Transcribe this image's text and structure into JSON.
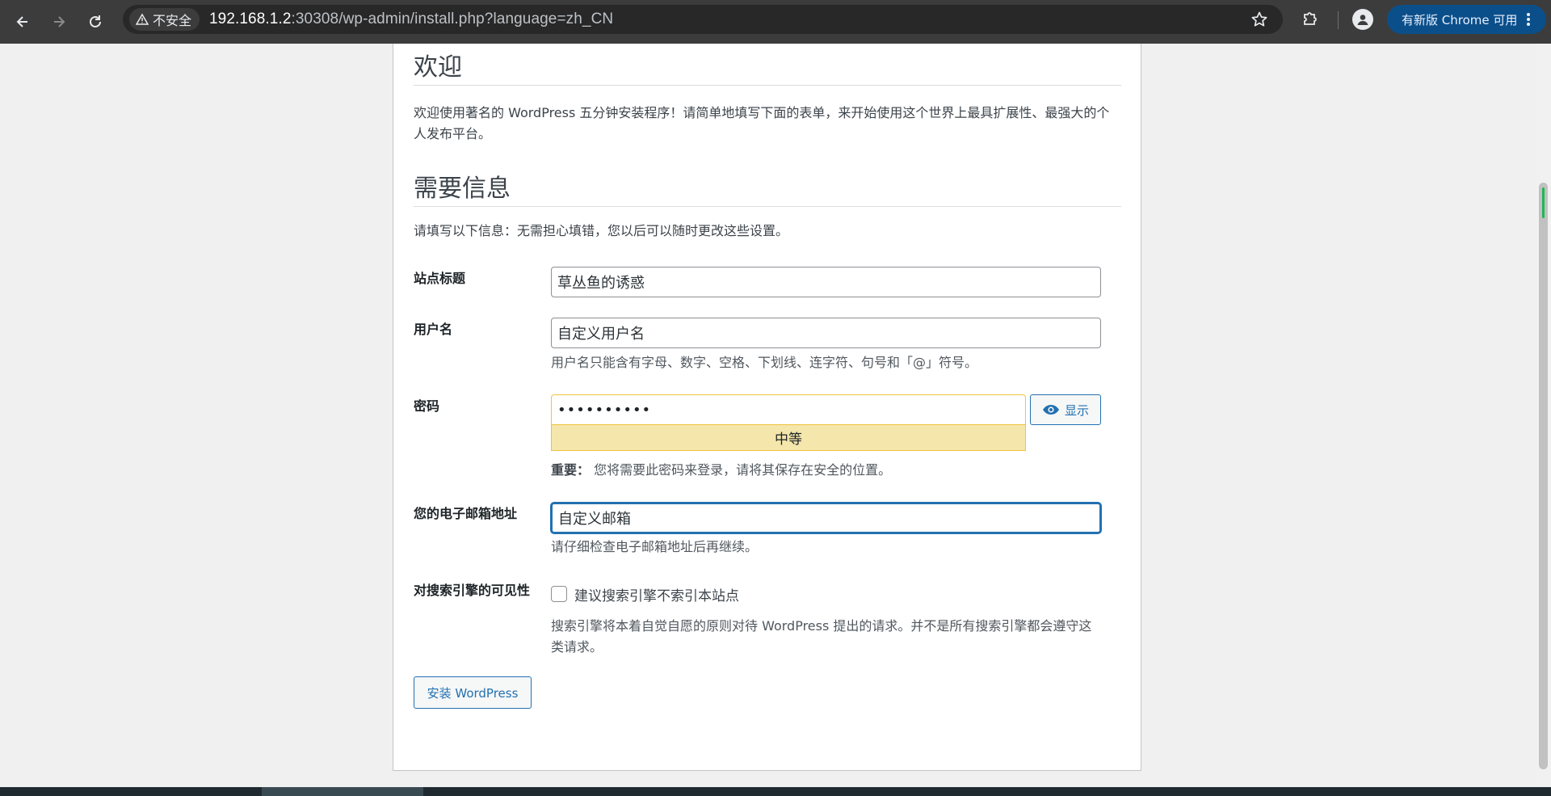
{
  "browser": {
    "security_label": "不安全",
    "url_host": "192.168.1.2",
    "url_rest": ":30308/wp-admin/install.php?language=zh_CN",
    "update_label": "有新版 Chrome 可用"
  },
  "page": {
    "welcome_heading": "欢迎",
    "welcome_text": "欢迎使用著名的 WordPress 五分钟安装程序！请简单地填写下面的表单，来开始使用这个世界上最具扩展性、最强大的个人发布平台。",
    "info_heading": "需要信息",
    "info_text": "请填写以下信息：无需担心填错，您以后可以随时更改这些设置。",
    "fields": {
      "site_title_label": "站点标题",
      "site_title_value": "草丛鱼的诱惑",
      "username_label": "用户名",
      "username_value": "自定义用户名",
      "username_hint": "用户名只能含有字母、数字、空格、下划线、连字符、句号和「@」符号。",
      "password_label": "密码",
      "password_value": "••••••••••",
      "password_strength": "中等",
      "show_label": "显示",
      "password_important": "重要：",
      "password_hint": "您将需要此密码来登录，请将其保存在安全的位置。",
      "email_label": "您的电子邮箱地址",
      "email_value": "自定义邮箱",
      "email_hint": "请仔细检查电子邮箱地址后再继续。",
      "visibility_label": "对搜索引擎的可见性",
      "visibility_checkbox": "建议搜索引擎不索引本站点",
      "visibility_hint": "搜索引擎将本着自觉自愿的原则对待 WordPress 提出的请求。并不是所有搜索引擎都会遵守这类请求。"
    },
    "install_button": "安装 WordPress"
  }
}
